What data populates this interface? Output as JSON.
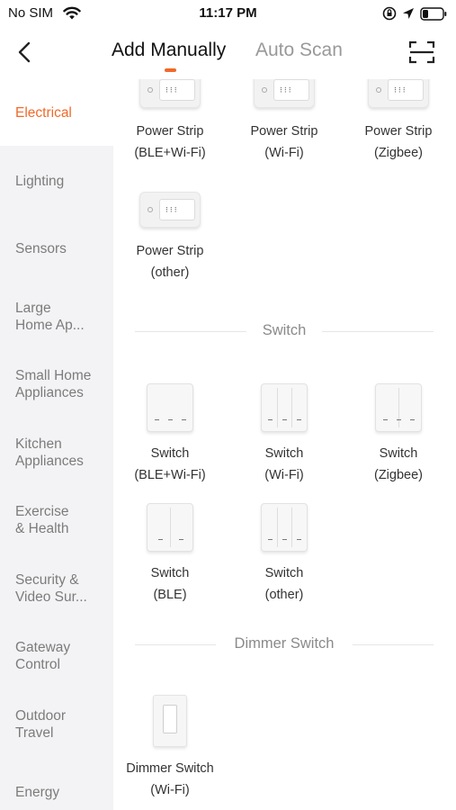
{
  "status_bar": {
    "carrier": "No SIM",
    "time": "11:17 PM"
  },
  "nav": {
    "tab_add_manually": "Add Manually",
    "tab_auto_scan": "Auto Scan",
    "accent_color": "#ef6a2a"
  },
  "sidebar": {
    "items": [
      {
        "label": "Electrical",
        "active": true
      },
      {
        "label": "Lighting"
      },
      {
        "label": "Sensors"
      },
      {
        "label": "Large\nHome Ap..."
      },
      {
        "label": "Small Home\nAppliances"
      },
      {
        "label": "Kitchen\nAppliances"
      },
      {
        "label": "Exercise\n& Health"
      },
      {
        "label": "Security &\nVideo Sur..."
      },
      {
        "label": "Gateway\nControl"
      },
      {
        "label": "Outdoor\nTravel"
      },
      {
        "label": "Energy"
      }
    ]
  },
  "sections": {
    "power_strip": {
      "devices": [
        {
          "name": "Power Strip",
          "variant": "(BLE+Wi-Fi)"
        },
        {
          "name": "Power Strip",
          "variant": "(Wi-Fi)"
        },
        {
          "name": "Power Strip",
          "variant": "(Zigbee)"
        },
        {
          "name": "Power Strip",
          "variant": "(other)"
        }
      ]
    },
    "switch": {
      "title": "Switch",
      "devices": [
        {
          "name": "Switch",
          "variant": "(BLE+Wi-Fi)"
        },
        {
          "name": "Switch",
          "variant": "(Wi-Fi)"
        },
        {
          "name": "Switch",
          "variant": "(Zigbee)"
        },
        {
          "name": "Switch",
          "variant": "(BLE)"
        },
        {
          "name": "Switch",
          "variant": "(other)"
        }
      ]
    },
    "dimmer_switch": {
      "title": "Dimmer Switch",
      "devices": [
        {
          "name": "Dimmer Switch",
          "variant": "(Wi-Fi)"
        }
      ]
    }
  }
}
